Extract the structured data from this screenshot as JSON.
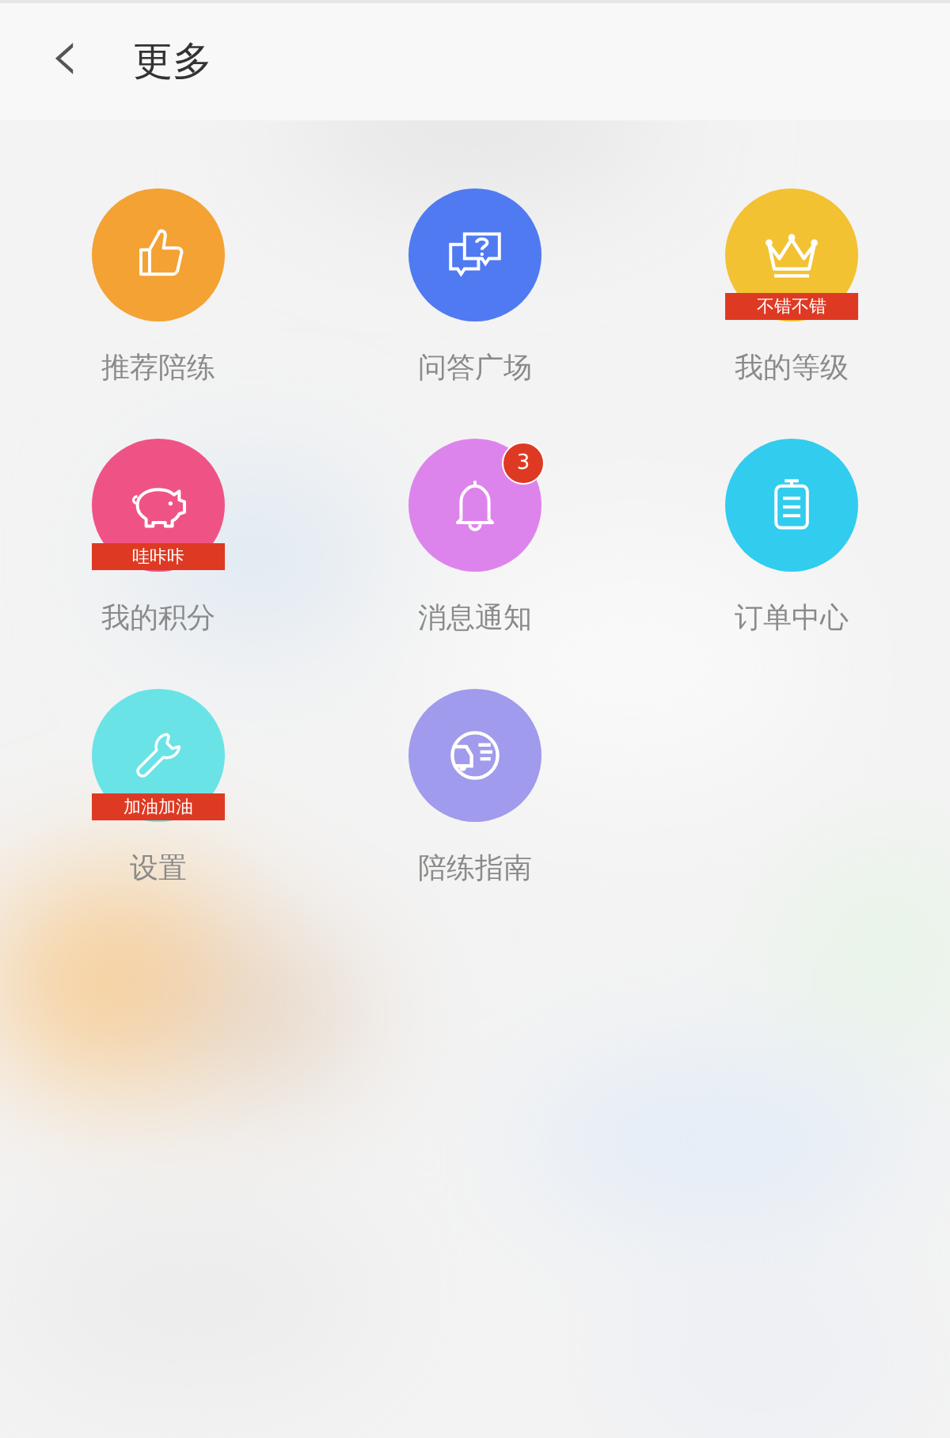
{
  "header": {
    "back_icon": "‹",
    "title": "更多"
  },
  "items": [
    {
      "label": "推荐陪练",
      "kind": "thumb",
      "color": "#f3a233"
    },
    {
      "label": "问答广场",
      "kind": "question",
      "color": "#507af2"
    },
    {
      "label": "我的等级",
      "kind": "crown",
      "color": "#f2c232",
      "ribbon": "不错不错"
    },
    {
      "label": "我的积分",
      "kind": "piggy",
      "color": "#ef5386",
      "ribbon": "哇咔咔"
    },
    {
      "label": "消息通知",
      "kind": "bell",
      "color": "#dd84ec",
      "count": "3"
    },
    {
      "label": "订单中心",
      "kind": "clipboard",
      "color": "#32ccef"
    },
    {
      "label": "设置",
      "kind": "wrench",
      "color": "#6ae3e6",
      "ribbon": "加油加油"
    },
    {
      "label": "陪练指南",
      "kind": "car",
      "color": "#a09bec"
    }
  ]
}
